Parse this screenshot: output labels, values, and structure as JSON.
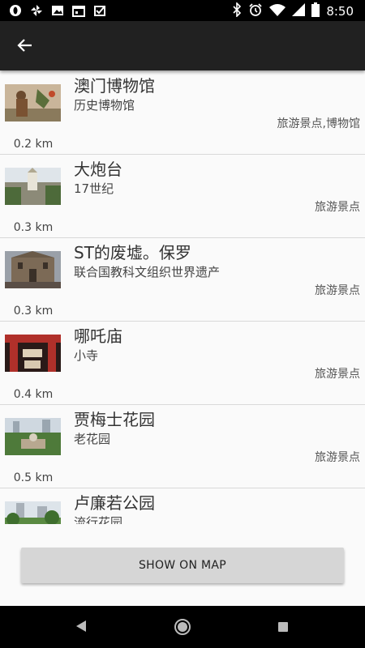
{
  "status_bar": {
    "time": "8:50",
    "left_icons": [
      "opera-icon",
      "pinwheel-icon",
      "image-icon",
      "calendar-icon",
      "check-icon"
    ],
    "right_icons": [
      "bluetooth-icon",
      "alarm-icon",
      "wifi-icon",
      "signal-icon",
      "battery-icon"
    ]
  },
  "app_bar": {
    "back_icon": "arrow-back-icon"
  },
  "items": [
    {
      "title": "澳门博物馆",
      "subtitle": "历史博物馆",
      "category": "旅游景点,博物馆",
      "distance": "0.2 km"
    },
    {
      "title": "大炮台",
      "subtitle": "17世纪",
      "category": "旅游景点",
      "distance": "0.3 km"
    },
    {
      "title": "ST的废墟。保罗",
      "subtitle": "联合国教科文组织世界遗产",
      "category": "旅游景点",
      "distance": "0.3 km"
    },
    {
      "title": "哪吒庙",
      "subtitle": "小寺",
      "category": "旅游景点",
      "distance": "0.4 km"
    },
    {
      "title": "贾梅士花园",
      "subtitle": "老花园",
      "category": "旅游景点",
      "distance": "0.5 km"
    },
    {
      "title": "卢廉若公园",
      "subtitle": "流行花园",
      "category": "",
      "distance": ""
    }
  ],
  "button": {
    "label": "SHOW ON MAP"
  },
  "colors": {
    "app_bar": "#212121",
    "status_bar": "#000000",
    "background": "#fafafa",
    "button": "#d6d6d6"
  }
}
